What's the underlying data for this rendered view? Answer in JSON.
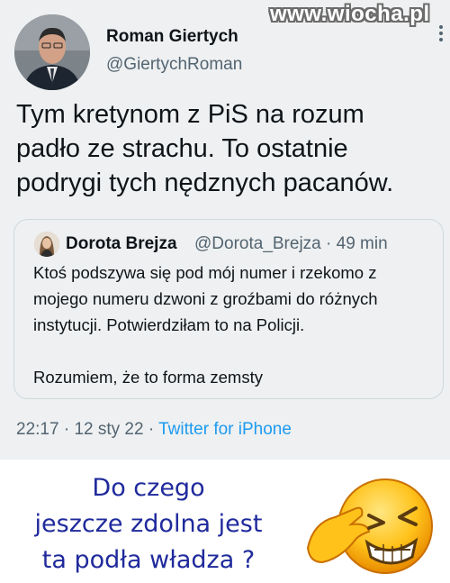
{
  "watermark": "www.wiocha.pl",
  "tweet": {
    "author_name": "Roman Giertych",
    "author_handle": "@GiertychRoman",
    "text_lines": [
      "Tym kretynom z PiS na rozum",
      "padło ze strachu. To ostatnie",
      "podrygi tych nędznych pacanów."
    ],
    "time": "22:17",
    "date": "12 sty 22",
    "source": "Twitter for iPhone",
    "separator": "·"
  },
  "quoted_tweet": {
    "author_name": "Dorota Brejza",
    "author_handle": "@Dorota_Brejza",
    "age": "49 min",
    "separator": "·",
    "text_lines": [
      "Ktoś podszywa się pod mój numer i rzekomo z",
      "mojego numeru dzwoni z groźbami do różnych",
      "instytucji. Potwierdziłam to na Policji."
    ],
    "text_line_last": "Rozumiem, że to forma zemsty"
  },
  "caption": {
    "lines": [
      "Do czego",
      "jeszcze zdolna jest",
      "ta podła władza ?"
    ]
  },
  "icons": {
    "more": "more-options-icon",
    "emoji": "headache-emoji-icon"
  },
  "colors": {
    "card_bg": "#eef0f1",
    "text_primary": "#0f1419",
    "text_secondary": "#536471",
    "link": "#1d9bf0",
    "caption": "#1f2a9c"
  }
}
